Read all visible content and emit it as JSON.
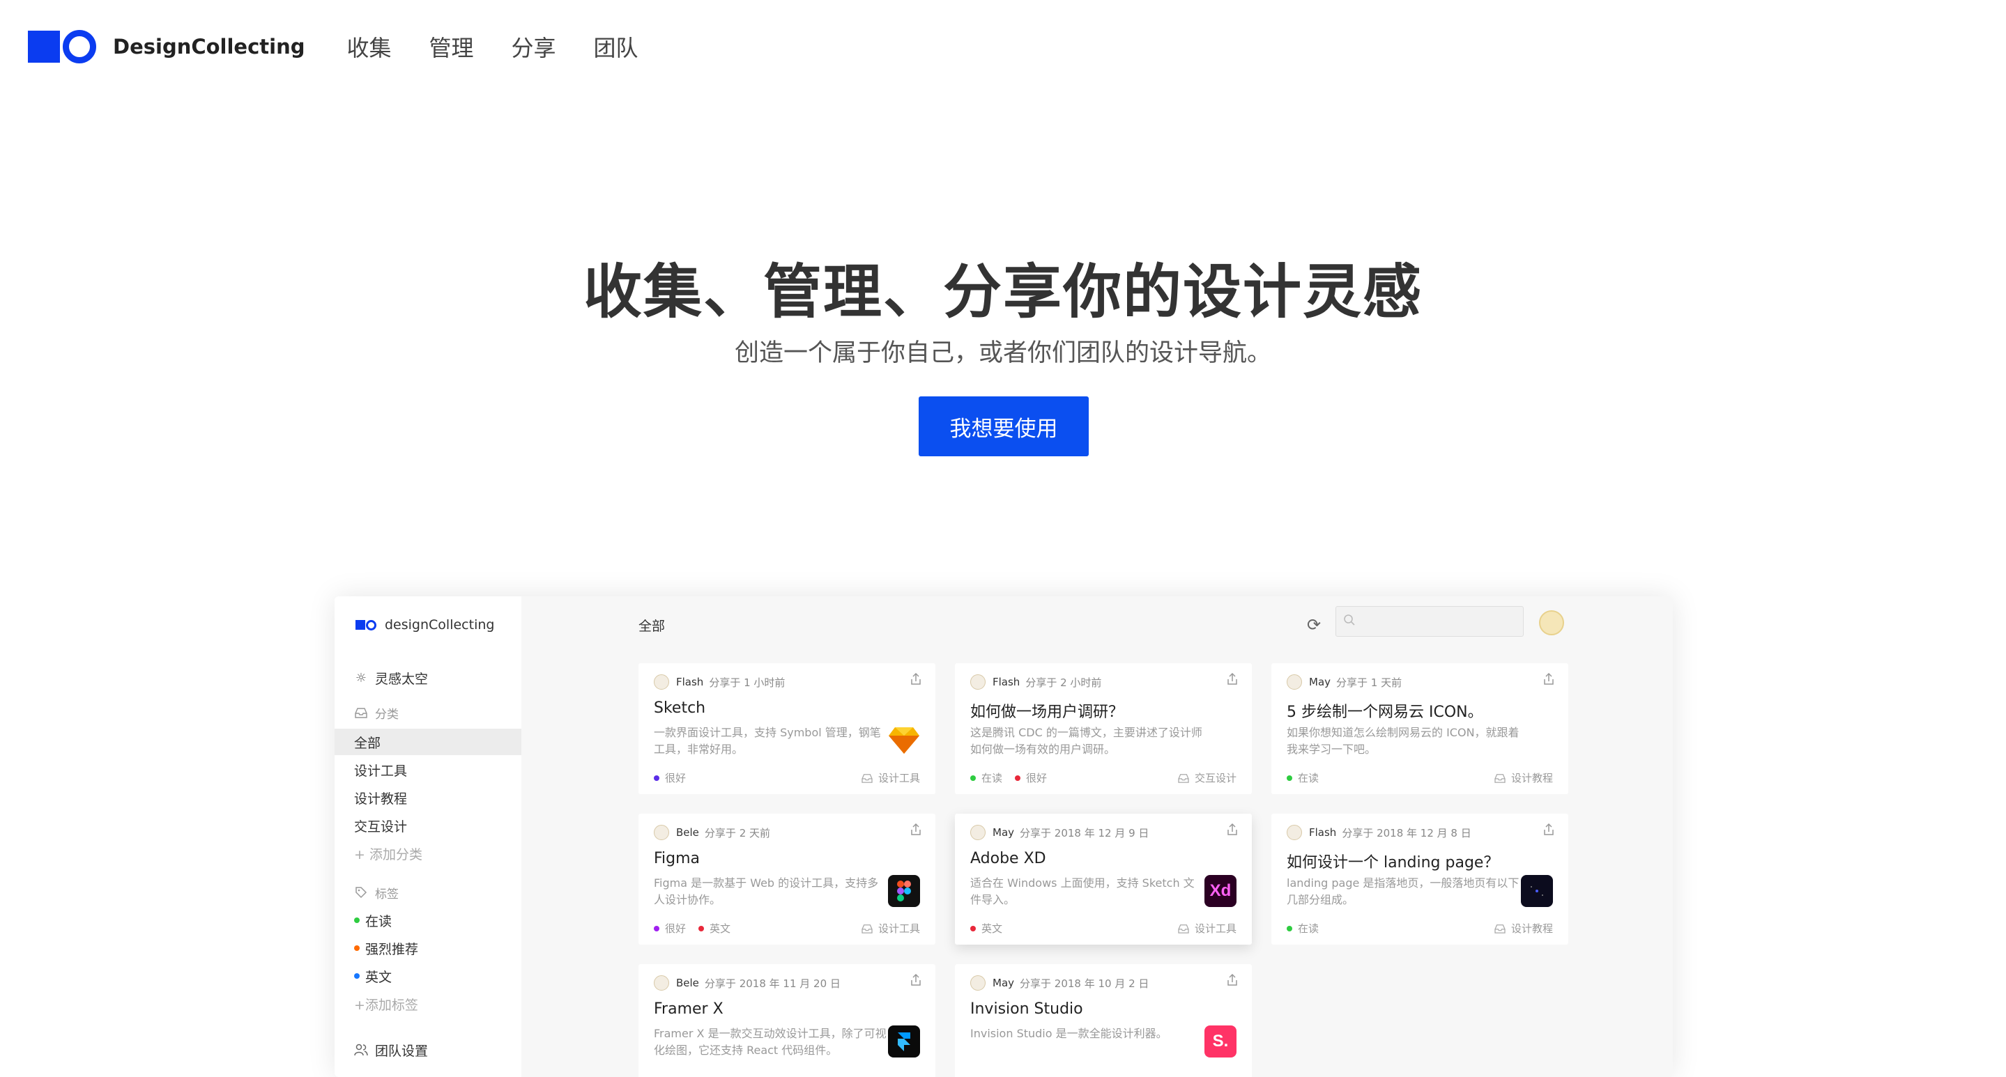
{
  "brand": {
    "name": "DesignCollecting"
  },
  "nav": [
    "收集",
    "管理",
    "分享",
    "团队"
  ],
  "hero": {
    "title": "收集、管理、分享你的设计灵感",
    "subtitle": "创造一个属于你自己，或者你们团队的设计导航。",
    "cta": "我想要使用"
  },
  "colors": {
    "brand": "#0b3cf0",
    "cta": "#0b4ff0"
  },
  "app": {
    "brand": "designCollecting",
    "main_title": "全部",
    "sidebar": {
      "inspiration": "灵感太空",
      "category_header": "分类",
      "categories": [
        "全部",
        "设计工具",
        "设计教程",
        "交互设计"
      ],
      "add_category": "+ 添加分类",
      "tag_header": "标签",
      "tags": [
        {
          "label": "在读",
          "color": "#2ecc40"
        },
        {
          "label": "强烈推荐",
          "color": "#ff6a00"
        },
        {
          "label": "英文",
          "color": "#1677ff"
        }
      ],
      "add_tag": "+添加标签",
      "team_settings": "团队设置"
    },
    "cards": [
      {
        "user": "Flash",
        "time": "分享于 1 小时前",
        "title": "Sketch",
        "desc": "一款界面设计工具，支持 Symbol 管理，钢笔工具，非常好用。",
        "tags": [
          {
            "label": "很好",
            "color": "#5b2ee8"
          }
        ],
        "category": "设计工具",
        "app_icon": "sketch-icon"
      },
      {
        "user": "Flash",
        "time": "分享于 2 小时前",
        "title": "如何做一场用户调研？",
        "desc": "这是腾讯 CDC 的一篇博文，主要讲述了设计师如何做一场有效的用户调研。",
        "tags": [
          {
            "label": "在读",
            "color": "#2ecc40"
          },
          {
            "label": "很好",
            "color": "#e8283a"
          }
        ],
        "category": "交互设计",
        "app_icon": ""
      },
      {
        "user": "May",
        "time": "分享于 1 天前",
        "title": "5 步绘制一个网易云 ICON。",
        "desc": "如果你想知道怎么绘制网易云的 ICON，就跟着我来学习一下吧。",
        "tags": [
          {
            "label": "在读",
            "color": "#2ecc40"
          }
        ],
        "category": "设计教程",
        "app_icon": ""
      },
      {
        "user": "Bele",
        "time": "分享于 2 天前",
        "title": "Figma",
        "desc": "Figma 是一款基于 Web 的设计工具，支持多人设计协作。",
        "tags": [
          {
            "label": "很好",
            "color": "#a020f0"
          },
          {
            "label": "英文",
            "color": "#e8283a"
          }
        ],
        "category": "设计工具",
        "app_icon": "figma-icon"
      },
      {
        "user": "May",
        "time": "分享于 2018 年 12 月 9 日",
        "title": "Adobe XD",
        "desc": "适合在 Windows 上面使用，支持 Sketch 文件导入。",
        "tags": [
          {
            "label": "英文",
            "color": "#e8283a"
          }
        ],
        "category": "设计工具",
        "app_icon": "adobe-xd-icon",
        "app_label": "Xd"
      },
      {
        "user": "Flash",
        "time": "分享于 2018 年 12 月 8 日",
        "title": "如何设计一个 landing page？",
        "desc": "landing page 是指落地页，一般落地页有以下几部分组成。",
        "tags": [
          {
            "label": "在读",
            "color": "#2ecc40"
          }
        ],
        "category": "设计教程",
        "app_icon": "landing-page-thumbnail"
      },
      {
        "user": "Bele",
        "time": "分享于 2018 年 11 月 20 日",
        "title": "Framer X",
        "desc": "Framer X 是一款交互动效设计工具，除了可视化绘图，它还支持 React 代码组件。",
        "tags": [],
        "category": "",
        "app_icon": "framer-icon"
      },
      {
        "user": "May",
        "time": "分享于 2018 年 10 月 2 日",
        "title": "Invision Studio",
        "desc": "Invision Studio 是一款全能设计利器。",
        "tags": [],
        "category": "",
        "app_icon": "invision-studio-icon",
        "app_label": "S."
      }
    ]
  }
}
